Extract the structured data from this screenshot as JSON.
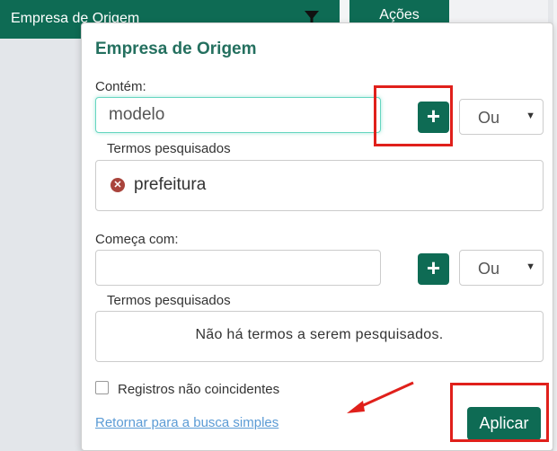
{
  "background": {
    "column_header": "Empresa de Origem",
    "filter_icon": "filter-icon",
    "actions_header": "Ações"
  },
  "popover": {
    "title": "Empresa de Origem",
    "contains": {
      "label": "Contém:",
      "input_value": "modelo",
      "add_icon": "plus-icon",
      "operator": "Ou",
      "terms_label": "Termos pesquisados",
      "terms": [
        "prefeitura"
      ],
      "remove_icon": "remove-circle-icon"
    },
    "starts_with": {
      "label": "Começa com:",
      "input_value": "",
      "add_icon": "plus-icon",
      "operator": "Ou",
      "terms_label": "Termos pesquisados",
      "empty_message": "Não há termos a serem pesquisados."
    },
    "non_matching_label": "Registros não coincidentes",
    "non_matching_checked": false,
    "back_link": "Retornar para a busca simples",
    "apply_button": "Aplicar"
  },
  "colors": {
    "brand_green": "#0e6b54",
    "title_green": "#24705f",
    "highlight_red": "#e0201b",
    "link_blue": "#5b9bd5"
  }
}
